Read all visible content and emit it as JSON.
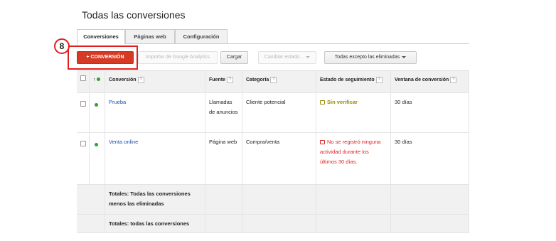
{
  "page": {
    "title": "Todas las conversiones"
  },
  "tabs": [
    {
      "label": "Conversiones",
      "active": true
    },
    {
      "label": "Páginas web",
      "active": false
    },
    {
      "label": "Configuración",
      "active": false
    }
  ],
  "toolbar": {
    "add_label": "+ CONVERSIÓN",
    "import_label": "Importar de Google Analytics",
    "upload_label": "Cargar",
    "change_status_label": "Cambiar estado...",
    "filter_label": "Todas excepto las eliminadas"
  },
  "annotation": {
    "step": "8",
    "color": "#e02020"
  },
  "table": {
    "headers": {
      "sort": "↑",
      "conversion": "Conversión",
      "source": "Fuente",
      "category": "Categoría",
      "tracking_status": "Estado de seguimiento",
      "window": "Ventana de conversión",
      "help": "?"
    },
    "rows": [
      {
        "name": "Prueba",
        "source": "Llamadas de anuncios",
        "category": "Cliente potencial",
        "status": "Sin verificar",
        "window": "30 días"
      },
      {
        "name": "Venta online",
        "source": "Página web",
        "category": "Compra/venta",
        "status": "No se registró ninguna actividad durante los últimos 30 días.",
        "window": "30 días"
      }
    ],
    "totals": [
      "Totales: Todas las conversiones menos las eliminadas",
      "Totales: todas las conversiones"
    ]
  },
  "colors": {
    "primary_button": "#d73a24",
    "enabled_dot": "#2aa52a",
    "link": "#1a4fb5",
    "warning": "#9a8a00",
    "error": "#dd2222"
  }
}
